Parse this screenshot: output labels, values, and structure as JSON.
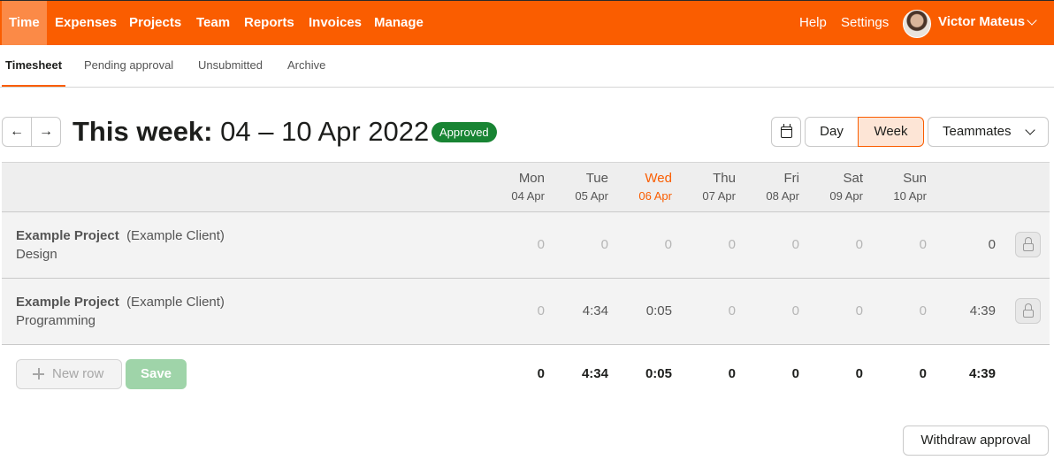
{
  "topnav": {
    "items": [
      "Time",
      "Expenses",
      "Projects",
      "Team",
      "Reports",
      "Invoices",
      "Manage"
    ],
    "active": "Time",
    "help": "Help",
    "settings": "Settings",
    "user_name": "Victor Mateus"
  },
  "colors": {
    "brand": "#fa5d00",
    "approved": "#188433",
    "save_disabled": "#9fd4a9"
  },
  "subnav": {
    "items": [
      "Timesheet",
      "Pending approval",
      "Unsubmitted",
      "Archive"
    ],
    "active": "Timesheet"
  },
  "week": {
    "title_prefix": "This week:",
    "range": "04 – 10 Apr 2022",
    "status": "Approved"
  },
  "view": {
    "day": "Day",
    "week": "Week",
    "active": "Week",
    "teammates": "Teammates"
  },
  "days": [
    {
      "name": "Mon",
      "date": "04 Apr"
    },
    {
      "name": "Tue",
      "date": "05 Apr"
    },
    {
      "name": "Wed",
      "date": "06 Apr",
      "today": true
    },
    {
      "name": "Thu",
      "date": "07 Apr"
    },
    {
      "name": "Fri",
      "date": "08 Apr"
    },
    {
      "name": "Sat",
      "date": "09 Apr"
    },
    {
      "name": "Sun",
      "date": "10 Apr"
    }
  ],
  "rows": [
    {
      "project": "Example Project",
      "client": "(Example Client)",
      "task": "Design",
      "hours": [
        "0",
        "0",
        "0",
        "0",
        "0",
        "0",
        "0"
      ],
      "total": "0"
    },
    {
      "project": "Example Project",
      "client": "(Example Client)",
      "task": "Programming",
      "hours": [
        "0",
        "4:34",
        "0:05",
        "0",
        "0",
        "0",
        "0"
      ],
      "total": "4:39"
    }
  ],
  "footer": {
    "new_row": "New row",
    "save": "Save",
    "totals": [
      "0",
      "4:34",
      "0:05",
      "0",
      "0",
      "0",
      "0"
    ],
    "grand_total": "4:39"
  },
  "withdraw": "Withdraw approval",
  "icons": {
    "arrow_left": "←",
    "arrow_right": "→"
  }
}
